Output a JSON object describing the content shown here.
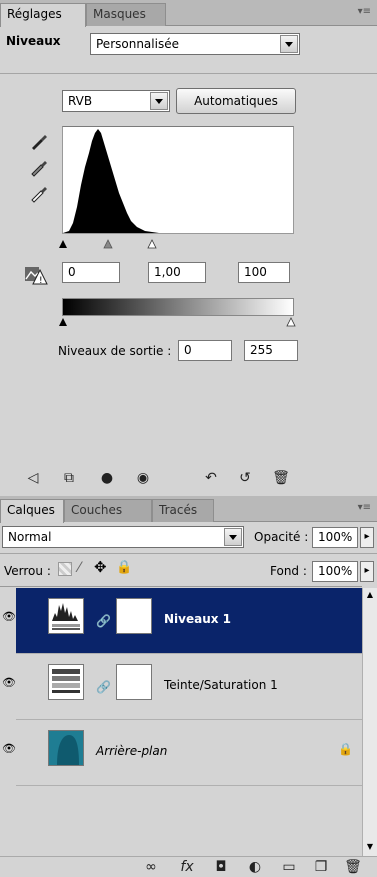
{
  "adjustments_panel": {
    "tabs": [
      {
        "label": "Réglages",
        "active": true
      },
      {
        "label": "Masques",
        "active": false
      }
    ],
    "title": "Niveaux",
    "preset_value": "Personnalisée",
    "channel_value": "RVB",
    "auto_button": "Automatiques",
    "input_levels": {
      "black": "0",
      "gamma": "1,00",
      "white": "100"
    },
    "output_label": "Niveaux de sortie :",
    "output_levels": {
      "black": "0",
      "white": "255"
    }
  },
  "layers_panel": {
    "tabs": [
      {
        "label": "Calques",
        "active": true
      },
      {
        "label": "Couches",
        "active": false
      },
      {
        "label": "Tracés",
        "active": false
      }
    ],
    "blend_mode": "Normal",
    "opacity_label": "Opacité :",
    "opacity_value": "100%",
    "lock_label": "Verrou :",
    "fill_label": "Fond :",
    "fill_value": "100%",
    "layers": [
      {
        "name": "Niveaux 1",
        "selected": true,
        "italic": false
      },
      {
        "name": "Teinte/Saturation 1",
        "selected": false,
        "italic": false
      },
      {
        "name": "Arrière-plan",
        "selected": false,
        "italic": true
      }
    ]
  },
  "colors": {
    "panel_bg": "#d4d4d4",
    "selection": "#0a246a",
    "layer_thumb_teal": "#1f7d93"
  }
}
